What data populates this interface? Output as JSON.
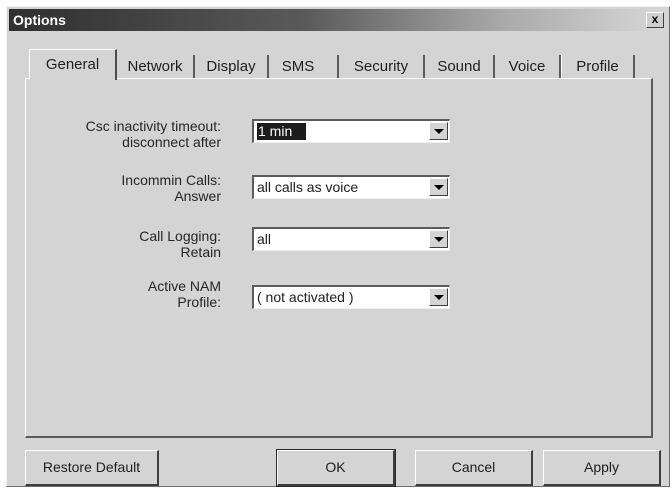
{
  "window": {
    "title": "Options",
    "close_label": "x"
  },
  "tabs": [
    {
      "label": "General",
      "active": true
    },
    {
      "label": "Network",
      "active": false
    },
    {
      "label": "Display",
      "active": false
    },
    {
      "label": "SMS",
      "active": false
    },
    {
      "label": "Security",
      "active": false
    },
    {
      "label": "Sound",
      "active": false
    },
    {
      "label": "Voice",
      "active": false
    },
    {
      "label": "Profile",
      "active": false
    }
  ],
  "settings": {
    "inactivity": {
      "label_line1": "Csc inactivity timeout:",
      "label_line2": "disconnect after",
      "value": "1 min"
    },
    "incoming": {
      "label_line1": "Incommin Calls:",
      "label_line2": "Answer",
      "value": "all calls as voice"
    },
    "logging": {
      "label_line1": "Call Logging:",
      "label_line2": "Retain",
      "value": "all"
    },
    "nam": {
      "label_line1": "Active NAM",
      "label_line2": "Profile:",
      "value": "( not activated )"
    }
  },
  "buttons": {
    "restore": "Restore Default",
    "ok": "OK",
    "cancel": "Cancel",
    "apply": "Apply"
  }
}
